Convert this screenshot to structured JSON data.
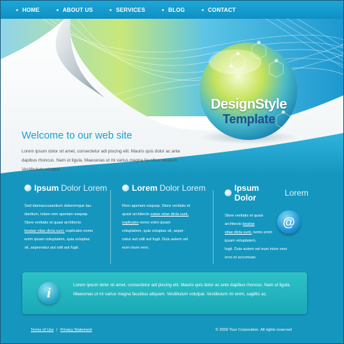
{
  "nav": {
    "items": [
      {
        "label": "HOME"
      },
      {
        "label": "ABOUT US"
      },
      {
        "label": "SERVICES"
      },
      {
        "label": "BLOG"
      },
      {
        "label": "CONTACT"
      }
    ]
  },
  "header": {
    "logo_line1": "DesignStyle",
    "logo_line2": "Template",
    "welcome": "Welcome to our web site",
    "intro": "Lorem ipsum dolor sit amet, consectetur adi piscing elit. Mauris quis dolor ac ante dapibus rhoncus. Nam ut ligula. Maecenas ut mi varius magna faucibus aliquam. Vestibulum volutpat."
  },
  "columns": [
    {
      "title_bold": "Ipsum",
      "title_light": "Dolor Lorem",
      "lines": [
        {
          "text": "Sed diamaccusantium doloremque lau-",
          "link": false
        },
        {
          "text": "dantium, totam rem aperiam eaquep.",
          "link": false
        },
        {
          "text": "Store veritatis et quasi architecto",
          "link": false
        },
        {
          "text": "beatae vitae dicta sunt,",
          "link": true,
          "after": " explicabo nemo"
        },
        {
          "text": "enim ipsam voluptatem, quia voluptas",
          "link": false
        },
        {
          "text": "sit, aspernatur aut odit aut fugit.",
          "link": false
        }
      ]
    },
    {
      "title_bold": "Lorem",
      "title_light": "Dolor Lorem",
      "lines": [
        {
          "text": "Rem aperiam eaquep. Store veritatis et",
          "link": false
        },
        {
          "text": "quasi architecto",
          "link": false,
          "linktail": "eatae vitae dicta sunt,"
        },
        {
          "text": "explicabo",
          "link": true,
          "after": " nemo enim ipsam"
        },
        {
          "text": "voluptatem, quia voluptas sit, asper-",
          "link": false
        },
        {
          "text": "natur aut odit aut fugit. Duis autem vel",
          "link": false
        },
        {
          "text": "eum iriure vero.",
          "link": false
        }
      ]
    },
    {
      "title_bold": "Ipsum Dolor",
      "title_light": "Lorem",
      "lines": [
        {
          "text": "Store veritatis et quasi",
          "link": false
        },
        {
          "text": "architecto",
          "link": false,
          "linktail": "beatae"
        },
        {
          "text": "vitae dicta sunt,",
          "link": true,
          "after": " nemo enim"
        },
        {
          "text": "ipsam voluptatem,",
          "link": false
        },
        {
          "text": "fugit. Duis autem vel eum iriure vero",
          "link": false
        },
        {
          "text": "eros et accumsan.",
          "link": false
        }
      ]
    }
  ],
  "mail_icon": "at-sign-icon",
  "info": {
    "icon": "info-icon",
    "text": "Lorem ipsum dolor sit amet, consectetur adi piscing elit. Mauris quis dolor ac ante dapibus rhoncus. Nam ut ligula. Maecenas ut mi varius magna faucibus aliquam. Vestibulum volutpat. Vestibulum mi enim, sagittis ac."
  },
  "footer": {
    "terms": "Terms of Use",
    "privacy": "Privacy Statement",
    "copyright": "© 2009 Your Corporation. All rights reserved"
  },
  "colors": {
    "accent": "#1a9fcf",
    "body_blue": "#1596be",
    "teal_box": "#22b4bf"
  }
}
